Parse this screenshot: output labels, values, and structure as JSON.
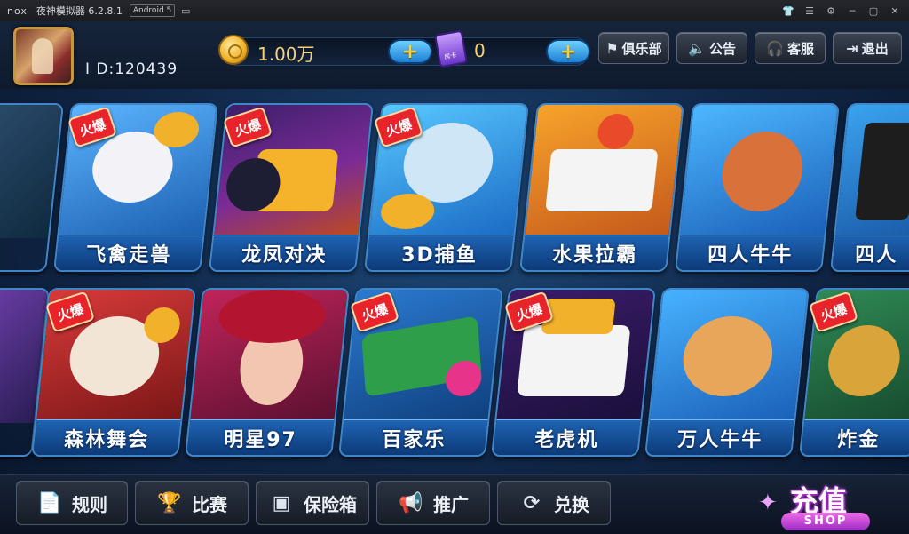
{
  "window": {
    "logo": "nox",
    "title": "夜神模拟器 6.2.8.1",
    "android_badge": "Android 5",
    "controls": [
      "shirt-icon",
      "menu-icon",
      "gear-icon",
      "minimize-icon",
      "maximize-icon",
      "close-icon"
    ]
  },
  "user": {
    "id_label": "I D:120439"
  },
  "currency": {
    "gold": "1.00万",
    "room_cards": "0",
    "card_icon_text": "房卡"
  },
  "top_buttons": {
    "club": "俱乐部",
    "notice": "公告",
    "service": "客服",
    "exit": "退出"
  },
  "hot_label": "火爆",
  "games_row1": [
    {
      "label": "飞禽走兽",
      "hot": true
    },
    {
      "label": "龙凤对决",
      "hot": true
    },
    {
      "label": "3D捕鱼",
      "hot": true
    },
    {
      "label": "水果拉霸",
      "hot": false
    },
    {
      "label": "四人牛牛",
      "hot": false
    },
    {
      "label": "四人",
      "hot": false
    }
  ],
  "games_row2": [
    {
      "label": "森林舞会",
      "hot": true
    },
    {
      "label": "明星97",
      "hot": false
    },
    {
      "label": "百家乐",
      "hot": true
    },
    {
      "label": "老虎机",
      "hot": true
    },
    {
      "label": "万人牛牛",
      "hot": false
    },
    {
      "label": "炸金",
      "hot": true
    }
  ],
  "bottom_buttons": {
    "rules": "规则",
    "match": "比赛",
    "safe": "保险箱",
    "promote": "推广",
    "exchange": "兑换"
  },
  "shop": {
    "main": "充值",
    "sub": "SHOP"
  },
  "colors": {
    "tile_label_bg": "#1f64b4",
    "hot_badge": "#e8242a",
    "gold_text": "#f5d27a",
    "plus_button": "#1c7fd3"
  }
}
